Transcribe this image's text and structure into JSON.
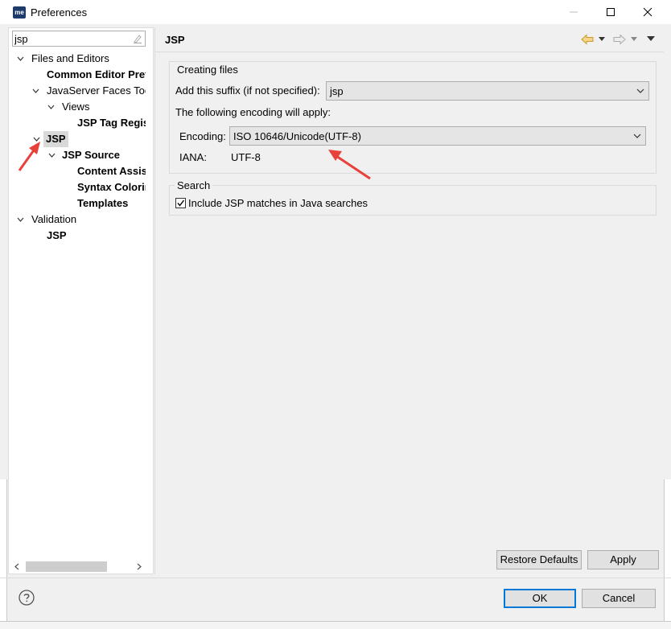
{
  "window": {
    "title": "Preferences",
    "app_icon_text": "me",
    "controls": [
      "minimize",
      "maximize",
      "close"
    ]
  },
  "sidebar": {
    "filter_value": "jsp",
    "tree": [
      {
        "label": "Files and Editors",
        "expanded": true,
        "bold": false
      },
      {
        "label": "Common Editor Pref",
        "bold": true
      },
      {
        "label": "JavaServer Faces Too",
        "expanded": true,
        "bold": false
      },
      {
        "label": "Views",
        "expanded": true,
        "bold": false
      },
      {
        "label": "JSP Tag Regis",
        "bold": true
      },
      {
        "label": "JSP",
        "expanded": true,
        "bold": true,
        "selected": true
      },
      {
        "label": "JSP Source",
        "expanded": true,
        "bold": true
      },
      {
        "label": "Content Assis",
        "bold": true
      },
      {
        "label": "Syntax Colorin",
        "bold": true
      },
      {
        "label": "Templates",
        "bold": true
      },
      {
        "label": "Validation",
        "expanded": true,
        "bold": false
      },
      {
        "label": "JSP",
        "bold": true
      }
    ]
  },
  "page": {
    "title": "JSP",
    "creating_files": {
      "group_label": "Creating files",
      "suffix_label": "Add this suffix (if not specified):",
      "suffix_value": "jsp",
      "encoding_note": "The following encoding will apply:",
      "encoding_label": "Encoding:",
      "encoding_value": "ISO 10646/Unicode(UTF-8)",
      "iana_label": "IANA:",
      "iana_value": "UTF-8"
    },
    "search": {
      "group_label": "Search",
      "checkbox_label": "Include JSP matches in Java searches",
      "checked": true
    },
    "restore_defaults_label": "Restore Defaults",
    "apply_label": "Apply"
  },
  "footer": {
    "ok_label": "OK",
    "cancel_label": "Cancel"
  },
  "colors": {
    "accent": "#0078d7",
    "annotation_arrow": "#e8413a",
    "selection": "#d9d9d9"
  }
}
